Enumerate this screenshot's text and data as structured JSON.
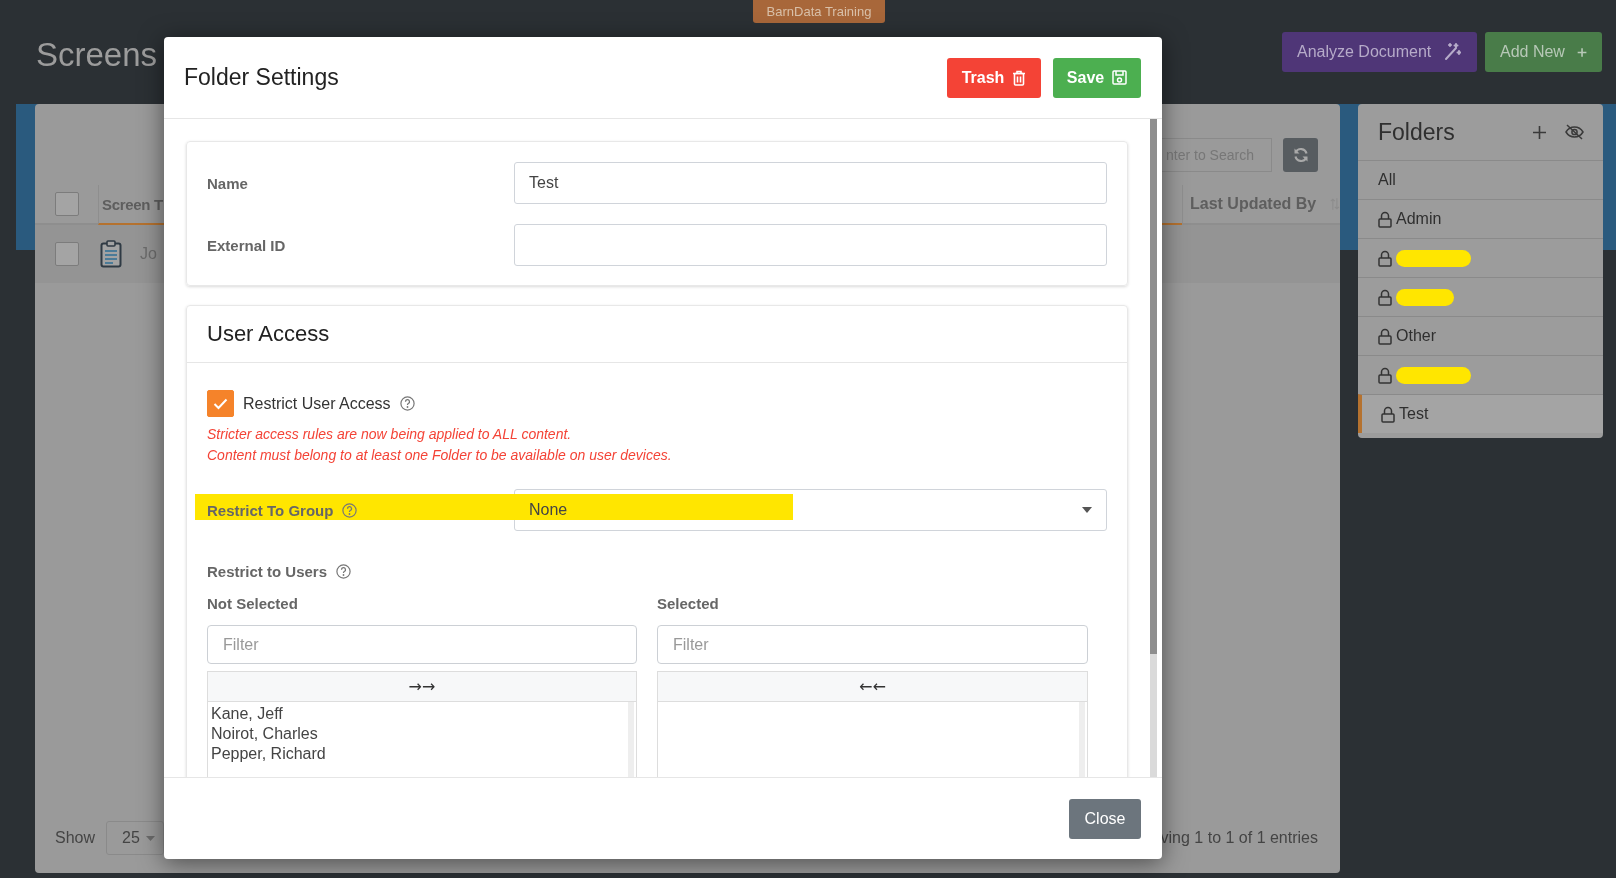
{
  "environment_badge": "BarnData Training",
  "page_title": "Screens",
  "header_actions": [
    {
      "label": "Analyze Document",
      "kind": "analyze"
    },
    {
      "label": "Add New",
      "kind": "add"
    }
  ],
  "screens_table": {
    "search": {
      "placeholder": "nter to Search"
    },
    "header_checked": false,
    "columns": [
      "Screen T",
      "Last Updated By"
    ],
    "rows": [
      {
        "checked": false,
        "screen_title": "Jo"
      }
    ],
    "show_label": "Show",
    "page_size": "25",
    "entries_info": "ving 1 to 1 of 1 entries"
  },
  "folders": {
    "title": "Folders",
    "items": [
      {
        "kind": "folder",
        "label": "All",
        "locked": false,
        "selected": false
      },
      {
        "kind": "folder",
        "label": "Admin",
        "locked": true,
        "selected": false
      },
      {
        "kind": "redacted",
        "locked": true,
        "selected": false
      },
      {
        "kind": "redacted",
        "locked": true,
        "selected": false
      },
      {
        "kind": "folder",
        "label": "Other",
        "locked": true,
        "selected": false
      },
      {
        "kind": "redacted",
        "locked": true,
        "selected": false
      },
      {
        "kind": "folder",
        "label": "Test",
        "locked": true,
        "selected": true
      }
    ]
  },
  "dialog": {
    "title": "Folder Settings",
    "actions": [
      {
        "label": "Trash",
        "kind": "trash"
      },
      {
        "label": "Save",
        "kind": "save"
      }
    ],
    "fields": [
      {
        "label": "Name",
        "value": "Test"
      },
      {
        "label": "External ID"
      }
    ],
    "user_access": {
      "title": "User Access",
      "restrict": {
        "label": "Restrict User Access",
        "checked": true
      },
      "warnings": [
        "Stricter access rules are now being applied to ALL content.",
        "Content must belong to at least one Folder to be available on user devices."
      ],
      "group": {
        "label": "Restrict To Group",
        "value": "None",
        "highlighted": true
      },
      "users_label": "Restrict to Users",
      "lists": [
        {
          "title": "Not Selected",
          "filter_placeholder": "Filter",
          "move_button": "→→",
          "items": [
            "Kane, Jeff",
            "Noirot, Charles",
            "Pepper, Richard"
          ]
        },
        {
          "title": "Selected",
          "filter_placeholder": "Filter",
          "move_button": "←←"
        }
      ]
    },
    "close_label": "Close"
  }
}
